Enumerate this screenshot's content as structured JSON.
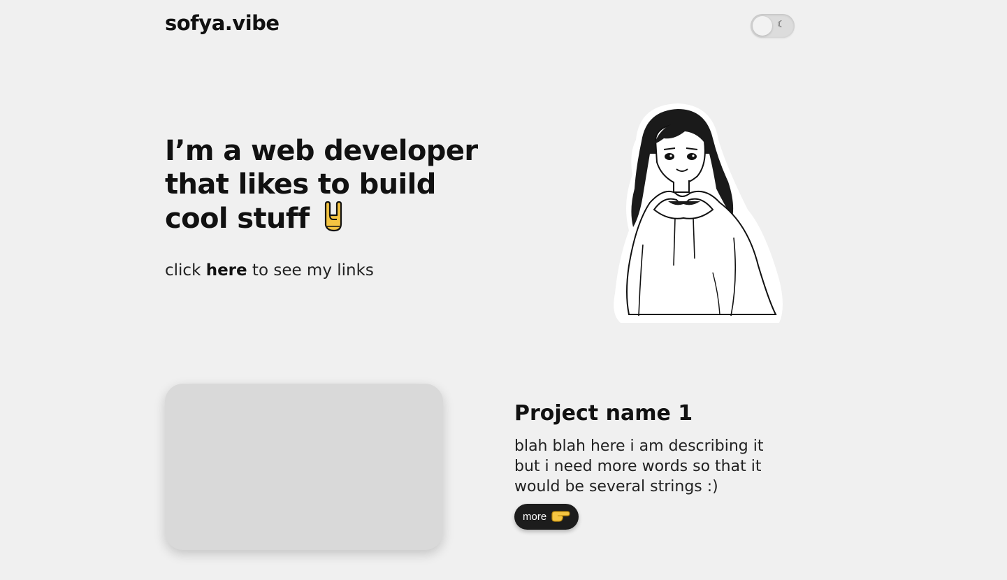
{
  "header": {
    "logo": "sofya.vibe",
    "theme_toggle_icon": "☾"
  },
  "hero": {
    "title": "I’m a web developer that likes to build cool stuff",
    "title_emoji": "rock-on-hand-icon",
    "subtitle_prefix": "click ",
    "subtitle_link": "here",
    "subtitle_suffix": " to see my links"
  },
  "project": {
    "title": "Project name 1",
    "description": "blah blah here i am describing it but i need more words so that it would be several strings :)",
    "more_label": "more",
    "more_icon": "pointing-hand-icon"
  }
}
